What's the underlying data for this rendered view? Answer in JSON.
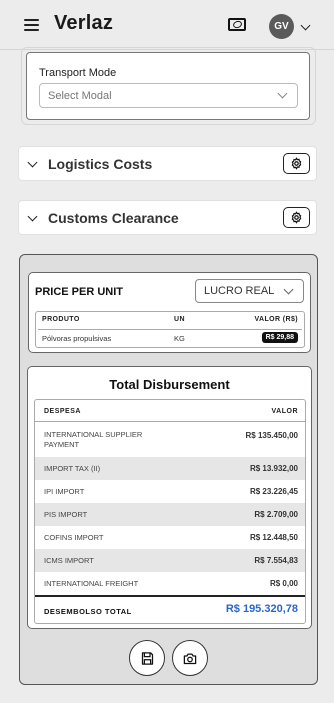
{
  "header": {
    "app_title": "Verlaz",
    "avatar_initials": "GV",
    "icons": [
      "menu-icon",
      "money-icon",
      "chevron-down-icon"
    ]
  },
  "transport": {
    "label": "Transport Mode",
    "placeholder": "Select Modal"
  },
  "sections": [
    {
      "title": "Logistics Costs"
    },
    {
      "title": "Customs Clearance"
    }
  ],
  "price_per_unit": {
    "title": "PRICE PER UNIT",
    "regime": "LUCRO REAL",
    "columns": [
      "PRODUTO",
      "UN",
      "VALOR (R$)"
    ],
    "rows": [
      {
        "product": "Pólvoras propulsivas",
        "unit": "KG",
        "value": "R$ 29,88"
      }
    ]
  },
  "total_disbursement": {
    "title": "Total Disbursement",
    "columns": [
      "DESPESA",
      "VALOR"
    ],
    "rows": [
      {
        "label": "INTERNATIONAL SUPPLIER PAYMENT",
        "value": "R$ 135.450,00"
      },
      {
        "label": "IMPORT TAX (II)",
        "value": "R$ 13.932,00"
      },
      {
        "label": "IPI IMPORT",
        "value": "R$ 23.226,45"
      },
      {
        "label": "PIS IMPORT",
        "value": "R$ 2.709,00"
      },
      {
        "label": "COFINS IMPORT",
        "value": "R$ 12.448,50"
      },
      {
        "label": "ICMS IMPORT",
        "value": "R$ 7.554,83"
      },
      {
        "label": "INTERNATIONAL FREIGHT",
        "value": "R$ 0,00"
      }
    ],
    "total_label": "DESEMBOLSO TOTAL",
    "total_value": "R$ 195.320,78",
    "total_color": "#2a66c9"
  },
  "actions": [
    "save-icon",
    "camera-icon"
  ]
}
